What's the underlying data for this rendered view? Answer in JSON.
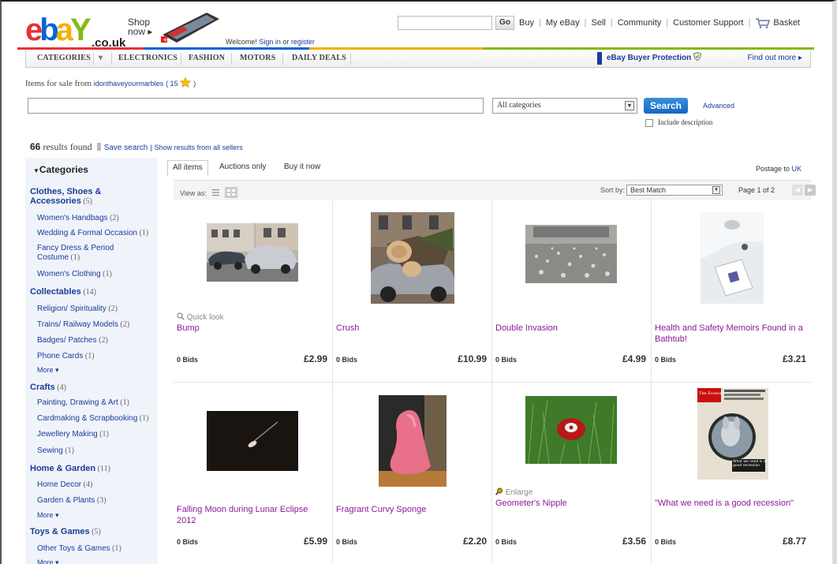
{
  "header": {
    "logo_text": [
      "e",
      "b",
      "a",
      "Y"
    ],
    "logo_suffix": ".co.uk",
    "shop_now": [
      "Shop",
      "now ▸"
    ],
    "welcome_prefix": "Welcome! ",
    "sign_in": "Sign in",
    "or": " or ",
    "register": "register",
    "go_label": "Go",
    "links": [
      "Buy",
      "My eBay",
      "Sell",
      "Community",
      "Customer Support",
      "Basket"
    ],
    "colors": [
      "#e53238",
      "#0064d2",
      "#f5af02",
      "#86b817"
    ]
  },
  "nav": {
    "items": [
      "Categories",
      "▾",
      "Electronics",
      "Fashion",
      "Motors",
      "Daily Deals"
    ],
    "protection": "eBay Buyer Protection",
    "find_out": "Find out more ▸"
  },
  "seller": {
    "prefix": "Items for sale from",
    "name": "idonthaveyourmarbles",
    "feedback": "( 15",
    "close": " )"
  },
  "search": {
    "value": "",
    "category": "All categories",
    "button": "Search",
    "advanced": "Advanced",
    "include_description": "Include description"
  },
  "results": {
    "count": "66",
    "found_label": " results found",
    "save_search": "Save search",
    "pipe": "|",
    "all_sellers": "Show results from all sellers"
  },
  "sidebar": {
    "heading": "Categories",
    "rows": [
      {
        "type": "main",
        "label": "Clothes, Shoes &",
        "count": ""
      },
      {
        "type": "main",
        "label": "Accessories",
        "count": " (5)"
      },
      {
        "type": "sub",
        "label": "Women's Handbags",
        "count": " (2)"
      },
      {
        "type": "sub",
        "label": "Wedding & Formal Occasion",
        "count": " (1)"
      },
      {
        "type": "sub",
        "label": "Fancy Dress & Period",
        "count": ""
      },
      {
        "type": "sub",
        "label": "Costume",
        "count": " (1)"
      },
      {
        "type": "sub",
        "label": "Women's Clothing",
        "count": " (1)"
      },
      {
        "type": "main",
        "label": "Collectables",
        "count": " (14)"
      },
      {
        "type": "sub",
        "label": "Religion/ Spirituality",
        "count": " (2)"
      },
      {
        "type": "sub",
        "label": "Trains/ Railway Models",
        "count": " (2)"
      },
      {
        "type": "sub",
        "label": "Badges/ Patches",
        "count": " (2)"
      },
      {
        "type": "sub",
        "label": "Phone Cards",
        "count": " (1)"
      },
      {
        "type": "more",
        "label": "More ▾",
        "count": ""
      },
      {
        "type": "main",
        "label": "Crafts",
        "count": " (4)"
      },
      {
        "type": "sub",
        "label": "Painting, Drawing & Art",
        "count": " (1)"
      },
      {
        "type": "sub",
        "label": "Cardmaking & Scrapbooking",
        "count": " (1)"
      },
      {
        "type": "sub",
        "label": "Jewellery Making",
        "count": " (1)"
      },
      {
        "type": "sub",
        "label": "Sewing",
        "count": " (1)"
      },
      {
        "type": "main",
        "label": "Home & Garden",
        "count": " (11)"
      },
      {
        "type": "sub",
        "label": "Home Decor",
        "count": " (4)"
      },
      {
        "type": "sub",
        "label": "Garden & Plants",
        "count": " (3)"
      },
      {
        "type": "more",
        "label": "More ▾",
        "count": ""
      },
      {
        "type": "main",
        "label": "Toys & Games",
        "count": " (5)"
      },
      {
        "type": "sub",
        "label": "Other Toys & Games",
        "count": " (1)"
      },
      {
        "type": "more",
        "label": "More ▾",
        "count": ""
      }
    ]
  },
  "tabs": [
    "All items",
    "Auctions only",
    "Buy it now"
  ],
  "postage": {
    "prefix": "Postage to ",
    "country": "UK"
  },
  "toolbar": {
    "view_as": "View as:",
    "sort_by": "Sort by:",
    "sort_value": "Best Match",
    "page": "Page 1 of 2"
  },
  "listings": [
    {
      "title": "Bump",
      "bids": "0 Bids",
      "price": "£2.99",
      "extra": "Quick look"
    },
    {
      "title": "Crush",
      "bids": "0 Bids",
      "price": "£10.99",
      "extra": ""
    },
    {
      "title": "Double Invasion",
      "bids": "0 Bids",
      "price": "£4.99",
      "extra": ""
    },
    {
      "title": "Health and Safety Memoirs Found in a Bathtub!",
      "bids": "0 Bids",
      "price": "£3.21",
      "extra": ""
    },
    {
      "title": "Falling Moon during Lunar Eclipse 2012",
      "bids": "0 Bids",
      "price": "£5.99",
      "extra": ""
    },
    {
      "title": "Fragrant Curvy Sponge",
      "bids": "0 Bids",
      "price": "£2.20",
      "extra": ""
    },
    {
      "title": "Geometer's Nipple",
      "bids": "0 Bids",
      "price": "£3.56",
      "extra": "Enlarge"
    },
    {
      "title": "\"What we need is a good recession\"",
      "bids": "0 Bids",
      "price": "£8.77",
      "extra": ""
    }
  ],
  "magazine": {
    "masthead": "The Economist",
    "cover_line": "What we need is a good recession"
  }
}
